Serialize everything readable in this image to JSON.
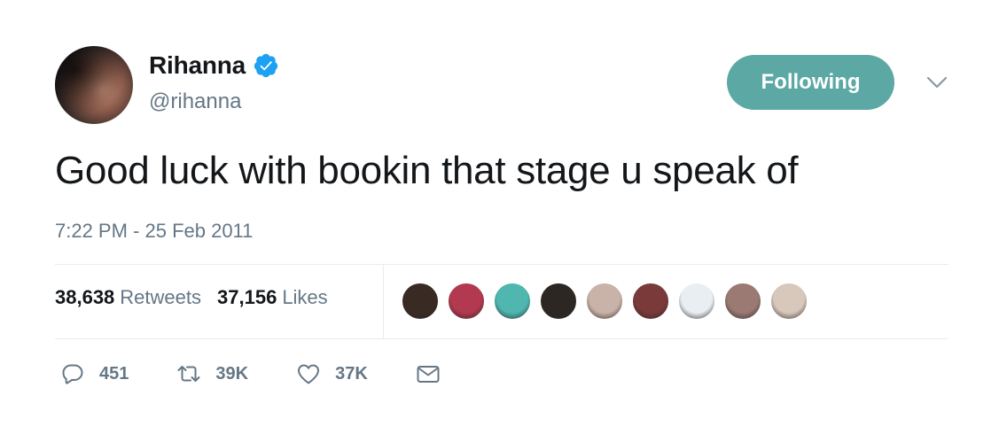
{
  "user": {
    "display_name": "Rihanna",
    "handle": "@rihanna",
    "verified": true
  },
  "follow_button": {
    "label": "Following",
    "color": "#5ba8a4"
  },
  "tweet": {
    "text": "Good luck with bookin that stage u speak of",
    "timestamp": "7:22 PM - 25 Feb 2011"
  },
  "stats": {
    "retweets_count": "38,638",
    "retweets_label": "Retweets",
    "likes_count": "37,156",
    "likes_label": "Likes"
  },
  "liker_avatars": [
    {
      "color": "#3a2a24"
    },
    {
      "color": "#b2394f"
    },
    {
      "color": "#4fb7b0"
    },
    {
      "color": "#2d2724"
    },
    {
      "color": "#c9b3a8"
    },
    {
      "color": "#7a3a3a"
    },
    {
      "color": "#e8eef2"
    },
    {
      "color": "#9a7a72"
    },
    {
      "color": "#d8c8bc"
    }
  ],
  "actions": {
    "reply_count": "451",
    "retweet_count": "39K",
    "like_count": "37K"
  },
  "colors": {
    "text_primary": "#14171a",
    "text_secondary": "#657786",
    "verified_blue": "#1da1f2",
    "divider": "#e6ecf0"
  }
}
